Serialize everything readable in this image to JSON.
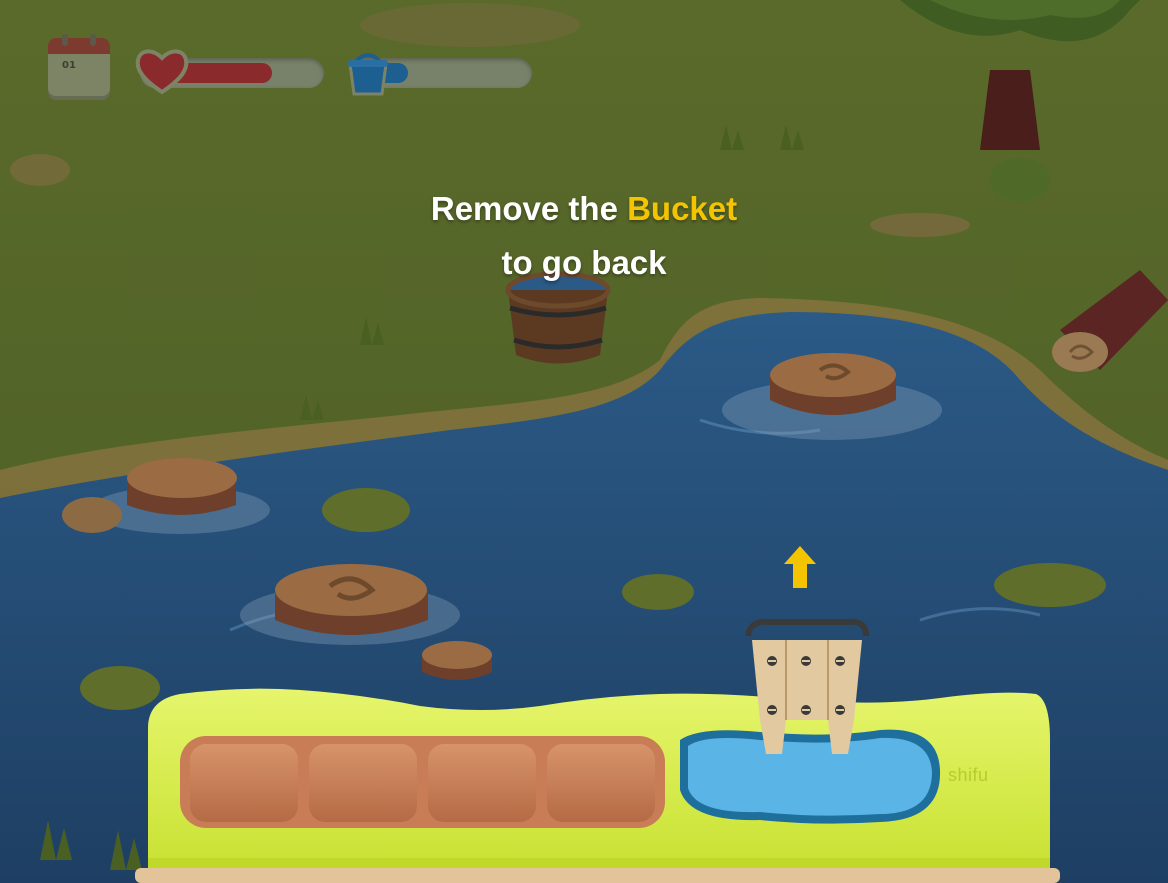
{
  "hud": {
    "calendar_day": "01",
    "health_level": 0.73,
    "water_level": 0.31,
    "colors": {
      "health": "#8b2a2d",
      "water": "#1d5f90",
      "track": "#78816a"
    }
  },
  "instruction": {
    "line1_prefix": "Remove the",
    "line1_highlight": "Bucket",
    "line2": "to go back",
    "highlight_color": "#f5c400"
  },
  "device": {
    "brand": "shifu",
    "letter_slots": 4,
    "water_slot_color": "#5ab4e6",
    "body_color": "#dbf05a"
  },
  "icons": [
    "calendar-icon",
    "heart-icon",
    "bucket-icon",
    "arrow-up-icon",
    "bucket-piece-icon"
  ]
}
